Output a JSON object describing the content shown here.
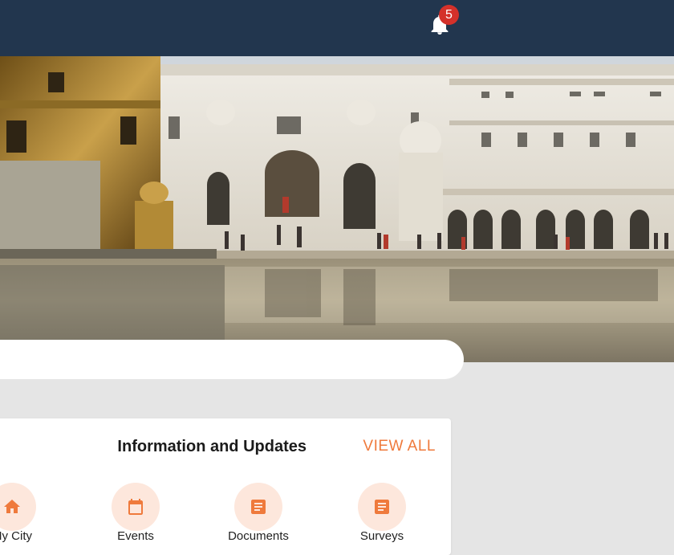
{
  "header": {
    "notification_count": "5",
    "bell_icon": "bell-icon"
  },
  "hero": {
    "image": "golden-temple-photo"
  },
  "search": {
    "placeholder": ""
  },
  "updates_card": {
    "title": "Information and Updates",
    "view_all_label": "VIEW ALL",
    "items": [
      {
        "label": "My City",
        "icon": "home-icon"
      },
      {
        "label": "Events",
        "icon": "calendar-icon"
      },
      {
        "label": "Documents",
        "icon": "document-icon"
      },
      {
        "label": "Surveys",
        "icon": "survey-icon"
      }
    ]
  },
  "colors": {
    "header_bg": "#22364e",
    "accent": "#ef7a3c",
    "badge": "#d4312a",
    "icon_circle": "#fde7dc"
  }
}
